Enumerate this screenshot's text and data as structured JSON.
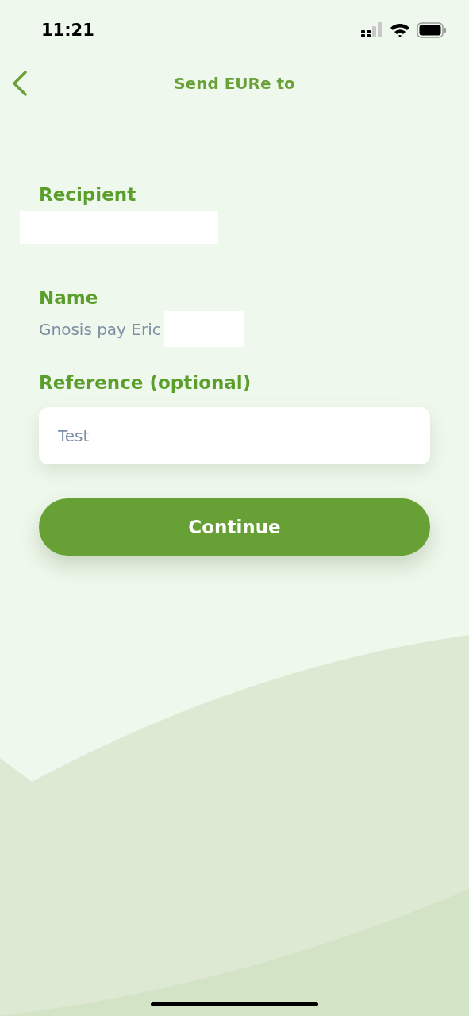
{
  "status_bar": {
    "time": "11:21"
  },
  "nav": {
    "title": "Send EURe to"
  },
  "recipient": {
    "label": "Recipient"
  },
  "name": {
    "label": "Name",
    "value": "Gnosis pay Eric"
  },
  "reference": {
    "label": "Reference (optional)",
    "value": "Test"
  },
  "continue_button": {
    "label": "Continue"
  }
}
